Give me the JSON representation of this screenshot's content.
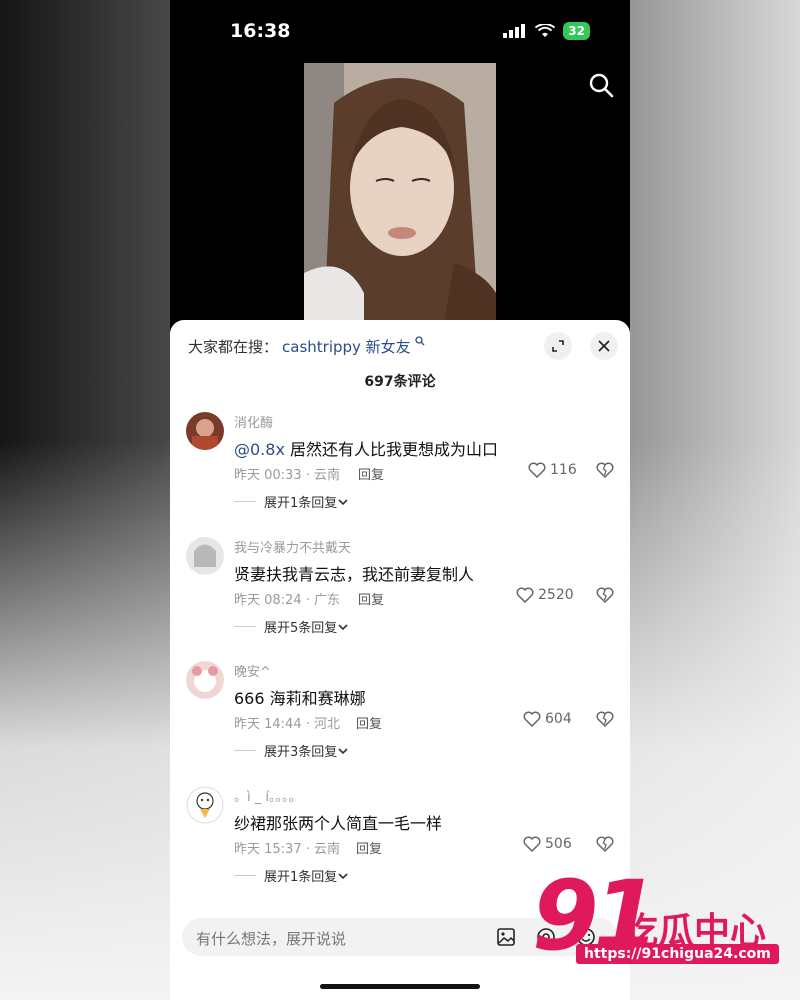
{
  "status_bar": {
    "time": "16:38",
    "battery": "32"
  },
  "search_bar": {
    "prefix": "大家都在搜：",
    "query": "cashtrippy 新女友"
  },
  "comment_count": "697条评论",
  "comments": [
    {
      "user": "消化酶",
      "mention": "@0.8x",
      "text": " 居然还有人比我更想成为山口",
      "meta": "昨天 00:33 · 云南",
      "reply": "回复",
      "likes": "116",
      "expand": "展开1条回复"
    },
    {
      "user": "我与冷暴力不共戴天",
      "mention": "",
      "text": "贤妻扶我青云志，我还前妻复制人",
      "meta": "昨天 08:24 · 广东",
      "reply": "回复",
      "likes": "2520",
      "expand": "展开5条回复"
    },
    {
      "user": "晚安^",
      "mention": "",
      "text": "666 海莉和赛琳娜",
      "meta": "昨天 14:44 · 河北",
      "reply": "回复",
      "likes": "604",
      "expand": "展开3条回复"
    },
    {
      "user": "。ì _ í。。。。",
      "mention": "",
      "text": "纱裙那张两个人简直一毛一样",
      "meta": "昨天 15:37 · 云南",
      "reply": "回复",
      "likes": "506",
      "expand": "展开1条回复"
    }
  ],
  "input": {
    "placeholder": "有什么想法，展开说说"
  },
  "watermark": {
    "number": "91",
    "name": "吃瓜中心",
    "url": "https://91chigua24.com"
  },
  "colors": {
    "accent_link": "#2a4d8a",
    "watermark": "#e0195c",
    "battery": "#34c759"
  },
  "icons": [
    "search-icon",
    "expand-icon",
    "close-icon",
    "heart-icon",
    "broken-heart-icon",
    "chevron-down-icon",
    "image-icon",
    "at-icon",
    "emoji-icon",
    "wifi-icon",
    "signal-icon"
  ]
}
